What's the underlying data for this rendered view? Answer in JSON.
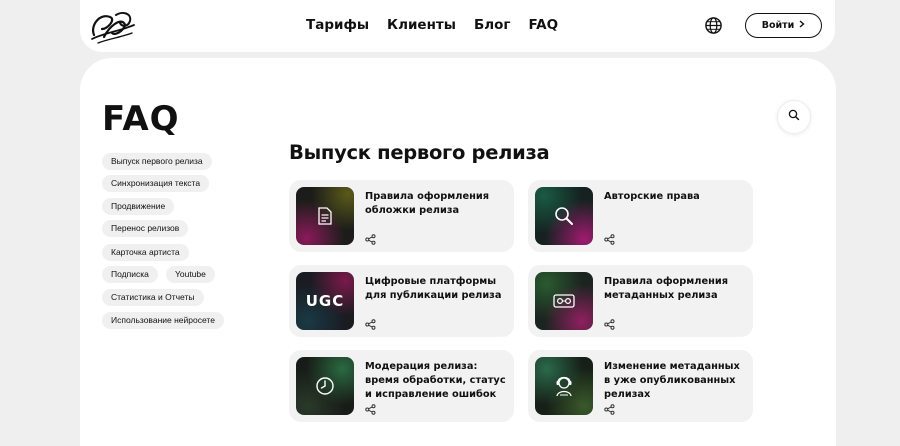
{
  "header": {
    "logo_icon": "handwritten-logo",
    "nav": [
      "Тарифы",
      "Клиенты",
      "Блог",
      "FAQ"
    ],
    "language_icon": "globe-icon",
    "login_label": "Войти",
    "login_icon": "chevron-right-icon"
  },
  "page": {
    "title": "FAQ",
    "search_icon": "search-icon"
  },
  "sidebar": {
    "chips": [
      "Выпуск первого релиза",
      "Синхронизация текста",
      "Продвижение",
      "Перенос релизов",
      "Карточка артиста",
      "Подписка",
      "Youtube",
      "Статистика и Отчеты",
      "Использование нейросете"
    ]
  },
  "section": {
    "title": "Выпуск первого релиза",
    "cards": [
      {
        "title": "Правила оформления обложки релиза",
        "icon": "image-file-icon"
      },
      {
        "title": "Авторские права",
        "icon": "magnifier-icon"
      },
      {
        "title": "Цифровые платформы для публикации релиза",
        "icon": "ugc-icon",
        "thumb_text": "UGC"
      },
      {
        "title": "Правила оформления метаданных релиза",
        "icon": "cassette-icon"
      },
      {
        "title": "Модерация релиза: время обработки, статус и исправление ошибок",
        "icon": "clock-icon"
      },
      {
        "title": "Изменение метаданных в уже опубликованных релизах",
        "icon": "music-person-icon"
      }
    ],
    "share_icon": "share-icon"
  }
}
